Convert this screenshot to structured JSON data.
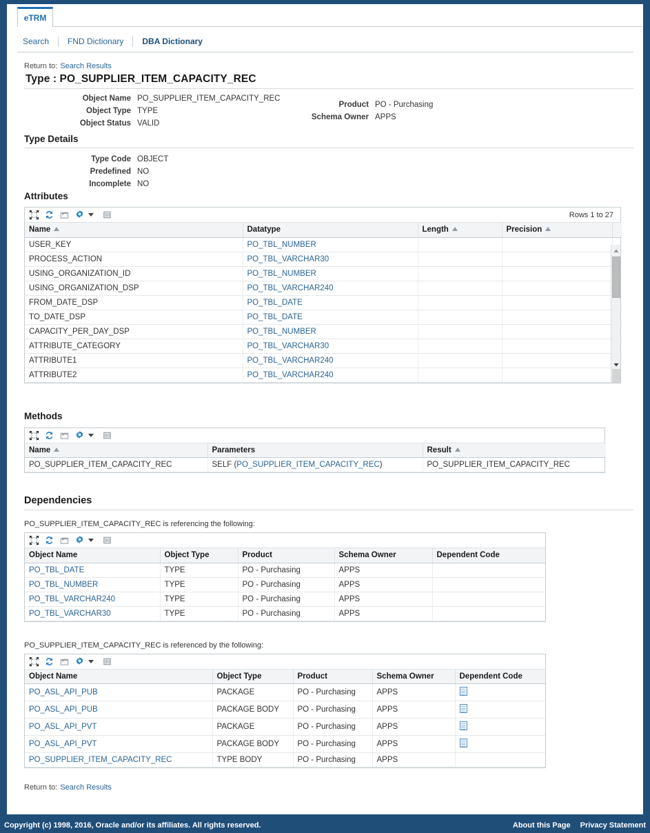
{
  "window": {
    "app_tab": "eTRM"
  },
  "subnav": [
    {
      "label": "Search",
      "current": false
    },
    {
      "label": "FND Dictionary",
      "current": false
    },
    {
      "label": "DBA Dictionary",
      "current": true
    }
  ],
  "top_return": {
    "prefix": "Return to:",
    "link": "Search Results"
  },
  "page_title": "Type : PO_SUPPLIER_ITEM_CAPACITY_REC",
  "header_info": {
    "left": [
      {
        "label": "Object Name",
        "value": "PO_SUPPLIER_ITEM_CAPACITY_REC"
      },
      {
        "label": "Object Type",
        "value": "TYPE"
      },
      {
        "label": "Object Status",
        "value": "VALID"
      }
    ],
    "right": [
      {
        "label": "Product",
        "value": "PO - Purchasing"
      },
      {
        "label": "Schema Owner",
        "value": "APPS"
      }
    ]
  },
  "type_details": {
    "heading": "Type Details",
    "rows": [
      {
        "label": "Type Code",
        "value": "OBJECT"
      },
      {
        "label": "Predefined",
        "value": "NO"
      },
      {
        "label": "Incomplete",
        "value": "NO"
      }
    ]
  },
  "toolbar_icons": [
    "detach-icon",
    "refresh-icon",
    "export-icon",
    "gear-icon",
    "columns-icon"
  ],
  "attributes": {
    "heading": "Attributes",
    "rows_info": "Rows 1 to 27",
    "columns": [
      "Name",
      "Datatype",
      "Length",
      "Precision"
    ],
    "sortable": [
      true,
      false,
      true,
      true
    ],
    "rows": [
      {
        "name": "USER_KEY",
        "datatype": "PO_TBL_NUMBER",
        "length": "",
        "precision": ""
      },
      {
        "name": "PROCESS_ACTION",
        "datatype": "PO_TBL_VARCHAR30",
        "length": "",
        "precision": ""
      },
      {
        "name": "USING_ORGANIZATION_ID",
        "datatype": "PO_TBL_NUMBER",
        "length": "",
        "precision": ""
      },
      {
        "name": "USING_ORGANIZATION_DSP",
        "datatype": "PO_TBL_VARCHAR240",
        "length": "",
        "precision": ""
      },
      {
        "name": "FROM_DATE_DSP",
        "datatype": "PO_TBL_DATE",
        "length": "",
        "precision": ""
      },
      {
        "name": "TO_DATE_DSP",
        "datatype": "PO_TBL_DATE",
        "length": "",
        "precision": ""
      },
      {
        "name": "CAPACITY_PER_DAY_DSP",
        "datatype": "PO_TBL_NUMBER",
        "length": "",
        "precision": ""
      },
      {
        "name": "ATTRIBUTE_CATEGORY",
        "datatype": "PO_TBL_VARCHAR30",
        "length": "",
        "precision": ""
      },
      {
        "name": "ATTRIBUTE1",
        "datatype": "PO_TBL_VARCHAR240",
        "length": "",
        "precision": ""
      },
      {
        "name": "ATTRIBUTE2",
        "datatype": "PO_TBL_VARCHAR240",
        "length": "",
        "precision": ""
      }
    ]
  },
  "methods": {
    "heading": "Methods",
    "columns": [
      "Name",
      "Parameters",
      "Result"
    ],
    "sortable": [
      true,
      false,
      true
    ],
    "rows": [
      {
        "name": "PO_SUPPLIER_ITEM_CAPACITY_REC",
        "param_prefix": "SELF (",
        "param_link": "PO_SUPPLIER_ITEM_CAPACITY_REC",
        "param_suffix": ")",
        "result": "PO_SUPPLIER_ITEM_CAPACITY_REC"
      }
    ]
  },
  "dependencies": {
    "heading": "Dependencies",
    "referencing_note": "PO_SUPPLIER_ITEM_CAPACITY_REC is referencing the following:",
    "referenced_by_note": "PO_SUPPLIER_ITEM_CAPACITY_REC is referenced by the following:",
    "columns": [
      "Object Name",
      "Object Type",
      "Product",
      "Schema Owner",
      "Dependent Code"
    ],
    "referencing": [
      {
        "object_name": "PO_TBL_DATE",
        "object_type": "TYPE",
        "product": "PO - Purchasing",
        "schema_owner": "APPS",
        "dependent_code": ""
      },
      {
        "object_name": "PO_TBL_NUMBER",
        "object_type": "TYPE",
        "product": "PO - Purchasing",
        "schema_owner": "APPS",
        "dependent_code": ""
      },
      {
        "object_name": "PO_TBL_VARCHAR240",
        "object_type": "TYPE",
        "product": "PO - Purchasing",
        "schema_owner": "APPS",
        "dependent_code": ""
      },
      {
        "object_name": "PO_TBL_VARCHAR30",
        "object_type": "TYPE",
        "product": "PO - Purchasing",
        "schema_owner": "APPS",
        "dependent_code": ""
      }
    ],
    "referenced_by": [
      {
        "object_name": "PO_ASL_API_PUB",
        "object_type": "PACKAGE",
        "product": "PO - Purchasing",
        "schema_owner": "APPS",
        "dependent_code": "document-icon"
      },
      {
        "object_name": "PO_ASL_API_PUB",
        "object_type": "PACKAGE BODY",
        "product": "PO - Purchasing",
        "schema_owner": "APPS",
        "dependent_code": "document-icon"
      },
      {
        "object_name": "PO_ASL_API_PVT",
        "object_type": "PACKAGE",
        "product": "PO - Purchasing",
        "schema_owner": "APPS",
        "dependent_code": "document-icon"
      },
      {
        "object_name": "PO_ASL_API_PVT",
        "object_type": "PACKAGE BODY",
        "product": "PO - Purchasing",
        "schema_owner": "APPS",
        "dependent_code": "document-icon"
      },
      {
        "object_name": "PO_SUPPLIER_ITEM_CAPACITY_REC",
        "object_type": "TYPE BODY",
        "product": "PO - Purchasing",
        "schema_owner": "APPS",
        "dependent_code": ""
      }
    ]
  },
  "bottom_return": {
    "prefix": "Return to:",
    "link": "Search Results"
  },
  "footer": {
    "copyright": "Copyright (c) 1998, 2016, Oracle and/or its affiliates. All rights reserved.",
    "links": [
      "About this Page",
      "Privacy Statement"
    ]
  },
  "colors": {
    "frame": "#1f4e79",
    "link": "#2a6496",
    "accent": "#1f6fb5",
    "header_bg": "#f2f4f6"
  }
}
